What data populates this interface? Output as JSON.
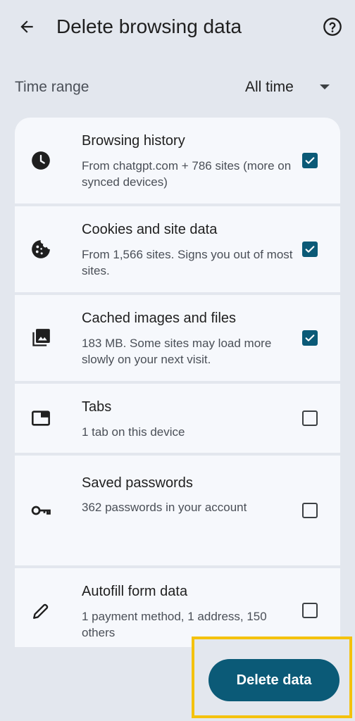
{
  "header": {
    "title": "Delete browsing data",
    "back_icon": "arrow-back-icon",
    "help_icon": "help-circle-icon"
  },
  "time_range": {
    "label": "Time range",
    "value": "All time"
  },
  "items": [
    {
      "title": "Browsing history",
      "desc": "From chatgpt.com + 786 sites (more on synced devices)",
      "checked": true,
      "icon": "clock-icon"
    },
    {
      "title": "Cookies and site data",
      "desc": "From 1,566 sites. Signs you out of most sites.",
      "checked": true,
      "icon": "cookie-icon"
    },
    {
      "title": "Cached images and files",
      "desc": "183 MB. Some sites may load more slowly on your next visit.",
      "checked": true,
      "icon": "image-stack-icon"
    },
    {
      "title": "Tabs",
      "desc": "1 tab on this device",
      "checked": false,
      "icon": "tab-icon"
    },
    {
      "title": "Saved passwords",
      "desc": "362 passwords in your account",
      "checked": false,
      "icon": "key-icon"
    },
    {
      "title": "Autofill form data",
      "desc": "1 payment method, 1 address, 150 others",
      "checked": false,
      "icon": "pencil-icon"
    }
  ],
  "footer": {
    "delete_label": "Delete data"
  },
  "colors": {
    "accent": "#0b5a77",
    "highlight": "#f4c20d",
    "background": "#e3e7ee",
    "card": "#f6f8fc"
  }
}
